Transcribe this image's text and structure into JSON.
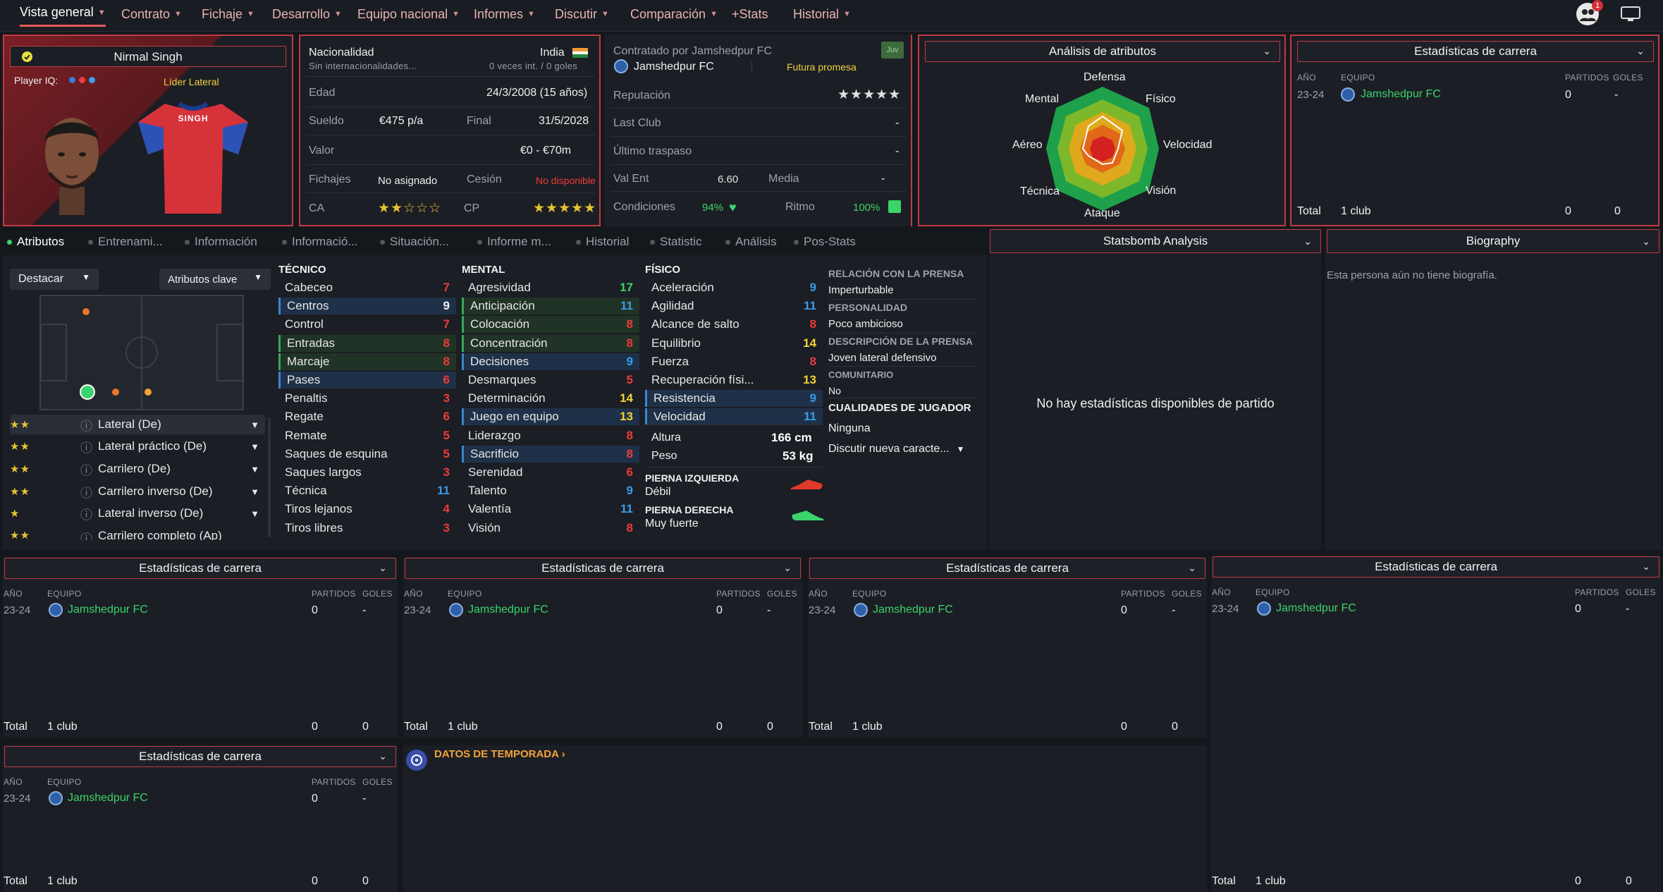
{
  "nav": {
    "items": [
      "Vista general",
      "Contrato",
      "Fichaje",
      "Desarrollo",
      "Equipo nacional",
      "Informes",
      "Discutir",
      "Comparación",
      "+Stats",
      "Historial"
    ],
    "badge": "1"
  },
  "player": {
    "name": "Nirmal Singh",
    "iq_label": "Player IQ:",
    "role": "Líder Lateral",
    "shirt_name": "SINGH"
  },
  "info": {
    "nat_label": "Nacionalidad",
    "nat_value": "India",
    "nat_sub": "Sin internacionalidades...",
    "caps": "0 veces int. / 0 goles",
    "edad_label": "Edad",
    "edad_value": "24/3/2008 (15 años)",
    "sueldo_label": "Sueldo",
    "sueldo_value": "€475 p/a",
    "final_label": "Final",
    "final_value": "31/5/2028",
    "valor_label": "Valor",
    "valor_value": "€0 - €70m",
    "fichajes_label": "Fichajes",
    "fichajes_value": "No asignado",
    "cesion_label": "Cesión",
    "cesion_value": "No disponible",
    "ca_label": "CA",
    "cp_label": "CP",
    "ca_stars": "★★☆☆☆",
    "cp_stars": "★★★★★"
  },
  "club": {
    "contract": "Contratado por Jamshedpur FC",
    "club": "Jamshedpur FC",
    "tag": "Juv",
    "status": "Futura promesa",
    "rep_label": "Reputación",
    "rep_stars": "★★★★★",
    "last_label": "Last Club",
    "last_value": "-",
    "traspaso_label": "Último traspaso",
    "traspaso_value": "-",
    "valent_label": "Val Ent",
    "valent_value": "6.60",
    "media_label": "Media",
    "media_value": "-",
    "cond_label": "Condiciones",
    "cond_value": "94%",
    "ritmo_label": "Ritmo",
    "ritmo_value": "100%"
  },
  "radar": {
    "title": "Análisis de atributos",
    "labels": [
      "Defensa",
      "Físico",
      "Velocidad",
      "Visión",
      "Ataque",
      "Técnica",
      "Aéreo",
      "Mental"
    ]
  },
  "career": {
    "title": "Estadísticas de carrera",
    "h_year": "AÑO",
    "h_team": "EQUIPO",
    "h_played": "PARTIDOS",
    "h_goals": "GOLES",
    "year": "23-24",
    "team": "Jamshedpur FC",
    "played": "0",
    "goals": "-",
    "total": "Total",
    "clubs": "1 club",
    "t_played": "0",
    "t_goals": "0"
  },
  "tabs": [
    "Atributos",
    "Entrenami...",
    "Información",
    "Informació...",
    "Situación...",
    "Informe m...",
    "Historial",
    "Statistic",
    "Análisis",
    "Pos-Stats"
  ],
  "left": {
    "dropdown1": "Destacar",
    "dropdown2": "Atributos clave",
    "positions": [
      {
        "name": "Lateral (De)",
        "stars": "★★"
      },
      {
        "name": "Lateral práctico (De)",
        "stars": "★★"
      },
      {
        "name": "Carrilero (De)",
        "stars": "★★"
      },
      {
        "name": "Carrilero inverso (De)",
        "stars": "★★"
      },
      {
        "name": "Lateral inverso (De)",
        "stars": "★"
      },
      {
        "name": "Carrilero completo (Ap)",
        "stars": "★★"
      }
    ]
  },
  "attrs": {
    "tec_title": "TÉCNICO",
    "men_title": "MENTAL",
    "fis_title": "FÍSICO",
    "tecnico": [
      [
        "Cabeceo",
        "7"
      ],
      [
        "Centros",
        "9"
      ],
      [
        "Control",
        "7"
      ],
      [
        "Entradas",
        "8"
      ],
      [
        "Marcaje",
        "8"
      ],
      [
        "Pases",
        "6"
      ],
      [
        "Penaltis",
        "3"
      ],
      [
        "Regate",
        "6"
      ],
      [
        "Remate",
        "5"
      ],
      [
        "Saques de esquina",
        "5"
      ],
      [
        "Saques largos",
        "3"
      ],
      [
        "Técnica",
        "11"
      ],
      [
        "Tiros lejanos",
        "4"
      ],
      [
        "Tiros libres",
        "3"
      ]
    ],
    "mental": [
      [
        "Agresividad",
        "17"
      ],
      [
        "Anticipación",
        "11"
      ],
      [
        "Colocación",
        "8"
      ],
      [
        "Concentración",
        "8"
      ],
      [
        "Decisiones",
        "9"
      ],
      [
        "Desmarques",
        "5"
      ],
      [
        "Determinación",
        "14"
      ],
      [
        "Juego en equipo",
        "13"
      ],
      [
        "Liderazgo",
        "8"
      ],
      [
        "Sacrificio",
        "8"
      ],
      [
        "Serenidad",
        "6"
      ],
      [
        "Talento",
        "9"
      ],
      [
        "Valentía",
        "11"
      ],
      [
        "Visión",
        "8"
      ]
    ],
    "fisico": [
      [
        "Aceleración",
        "9"
      ],
      [
        "Agilidad",
        "11"
      ],
      [
        "Alcance de salto",
        "8"
      ],
      [
        "Equilibrio",
        "14"
      ],
      [
        "Fuerza",
        "8"
      ],
      [
        "Recuperación físi...",
        "13"
      ],
      [
        "Resistencia",
        "9"
      ],
      [
        "Velocidad",
        "11"
      ]
    ],
    "altura_label": "Altura",
    "altura_value": "166 cm",
    "peso_label": "Peso",
    "peso_value": "53 kg",
    "pie_izq_label": "PIERNA IZQUIERDA",
    "pie_izq_value": "Débil",
    "pie_der_label": "PIERNA DERECHA",
    "pie_der_value": "Muy fuerte"
  },
  "press": {
    "h1": "RELACIÓN CON LA PRENSA",
    "v1": "Imperturbable",
    "h2": "PERSONALIDAD",
    "v2": "Poco ambicioso",
    "h3": "DESCRIPCIÓN DE LA PRENSA",
    "v3": "Joven lateral defensivo",
    "h4": "COMUNITARIO",
    "v4": "No",
    "h5": "CUALIDADES DE JUGADOR",
    "v5": "Ninguna",
    "v6": "Discutir nueva caracte..."
  },
  "statsbomb": {
    "title": "Statsbomb Analysis",
    "empty": "No hay estadísticas disponibles de partido"
  },
  "bio": {
    "title": "Biography",
    "text": "Esta persona aún no tiene biografía."
  },
  "season": {
    "title": "DATOS DE TEMPORADA"
  }
}
